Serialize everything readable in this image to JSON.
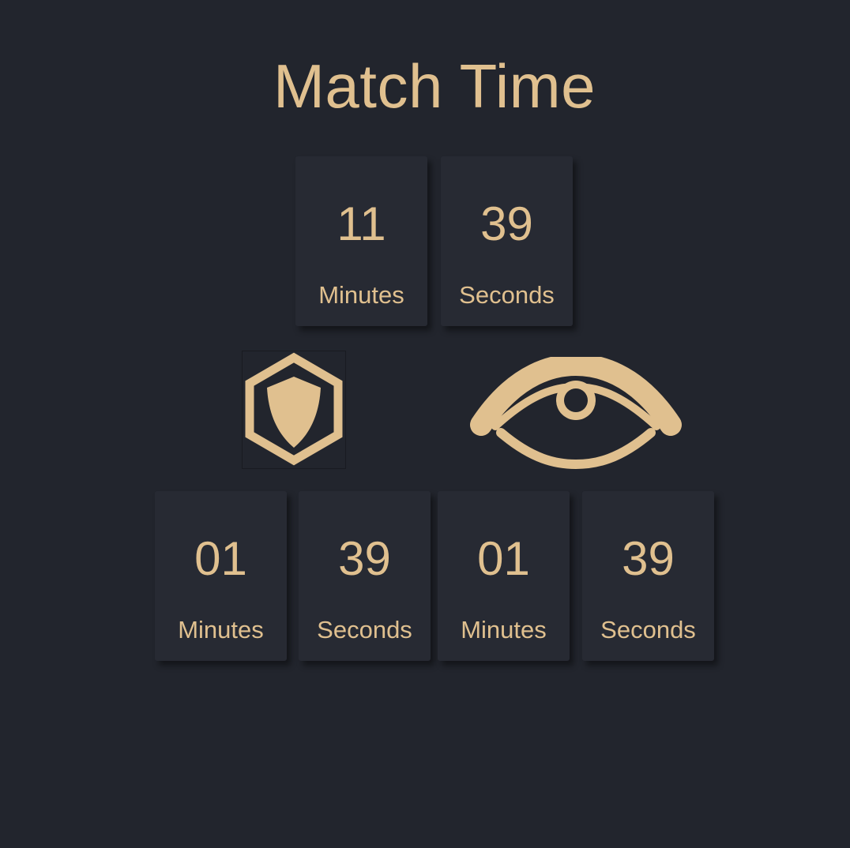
{
  "title": "Match Time",
  "match_timer": {
    "minutes": {
      "value": "11",
      "unit": "Minutes"
    },
    "seconds": {
      "value": "39",
      "unit": "Seconds"
    }
  },
  "defense_timer": {
    "icon": "hexagon-shield-icon",
    "minutes": {
      "value": "01",
      "unit": "Minutes"
    },
    "seconds": {
      "value": "39",
      "unit": "Seconds"
    }
  },
  "vision_timer": {
    "icon": "eye-icon",
    "minutes": {
      "value": "01",
      "unit": "Minutes"
    },
    "seconds": {
      "value": "39",
      "unit": "Seconds"
    }
  },
  "colors": {
    "background": "#22252d",
    "card": "#272a33",
    "accent": "#e0c08f"
  }
}
